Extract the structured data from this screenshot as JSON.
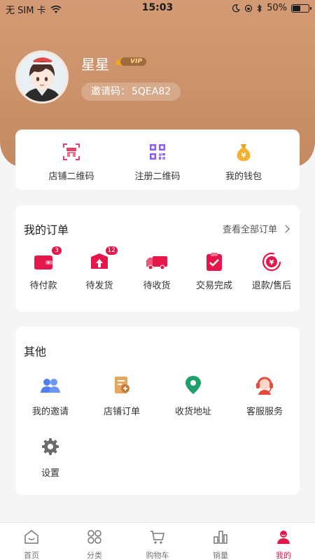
{
  "status_bar": {
    "carrier": "无 SIM 卡",
    "time": "15:03",
    "battery_text": "50%",
    "battery_level": 0.5
  },
  "profile": {
    "name": "星星",
    "vip_label": "VIP",
    "invite_label": "邀请码：",
    "invite_code": "5QEA82"
  },
  "quick_links": [
    {
      "label": "店铺二维码",
      "icon": "store-qr-icon"
    },
    {
      "label": "注册二维码",
      "icon": "register-qr-icon"
    },
    {
      "label": "我的钱包",
      "icon": "wallet-icon"
    }
  ],
  "orders": {
    "title": "我的订单",
    "view_all": "查看全部订单",
    "items": [
      {
        "label": "待付款",
        "badge": "3",
        "icon": "wallet-pay-icon"
      },
      {
        "label": "待发货",
        "badge": "12",
        "icon": "box-up-icon"
      },
      {
        "label": "待收货",
        "badge": "",
        "icon": "truck-icon"
      },
      {
        "label": "交易完成",
        "badge": "",
        "icon": "clipboard-check-icon"
      },
      {
        "label": "退款/售后",
        "badge": "",
        "icon": "refund-icon"
      }
    ]
  },
  "other": {
    "title": "其他",
    "items": [
      {
        "label": "我的邀请",
        "icon": "users-icon"
      },
      {
        "label": "店铺订单",
        "icon": "store-order-icon"
      },
      {
        "label": "收货地址",
        "icon": "location-pin-icon"
      },
      {
        "label": "客服服务",
        "icon": "customer-service-icon"
      },
      {
        "label": "设置",
        "icon": "gear-icon"
      }
    ]
  },
  "tabbar": [
    {
      "label": "首页",
      "icon": "home-icon"
    },
    {
      "label": "分类",
      "icon": "category-icon"
    },
    {
      "label": "购物车",
      "icon": "cart-icon"
    },
    {
      "label": "销量",
      "icon": "sales-chart-icon"
    },
    {
      "label": "我的",
      "icon": "profile-icon",
      "active": true
    }
  ],
  "colors": {
    "header": "#c98d63",
    "accent": "#e5174a",
    "gold": "#f0a020",
    "purple": "#8b5cf6",
    "blue": "#4f7ef2",
    "green": "#22a06b"
  }
}
